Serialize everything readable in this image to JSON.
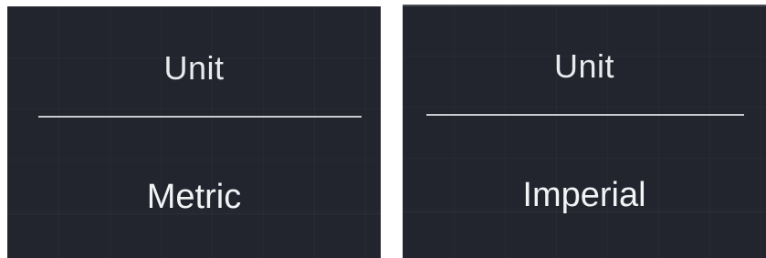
{
  "panels": [
    {
      "title": "Unit",
      "value": "Metric"
    },
    {
      "title": "Unit",
      "value": "Imperial"
    }
  ],
  "colors": {
    "panel_background": "#22252e",
    "text": "#e9eaee",
    "divider": "#c9cbd1"
  }
}
